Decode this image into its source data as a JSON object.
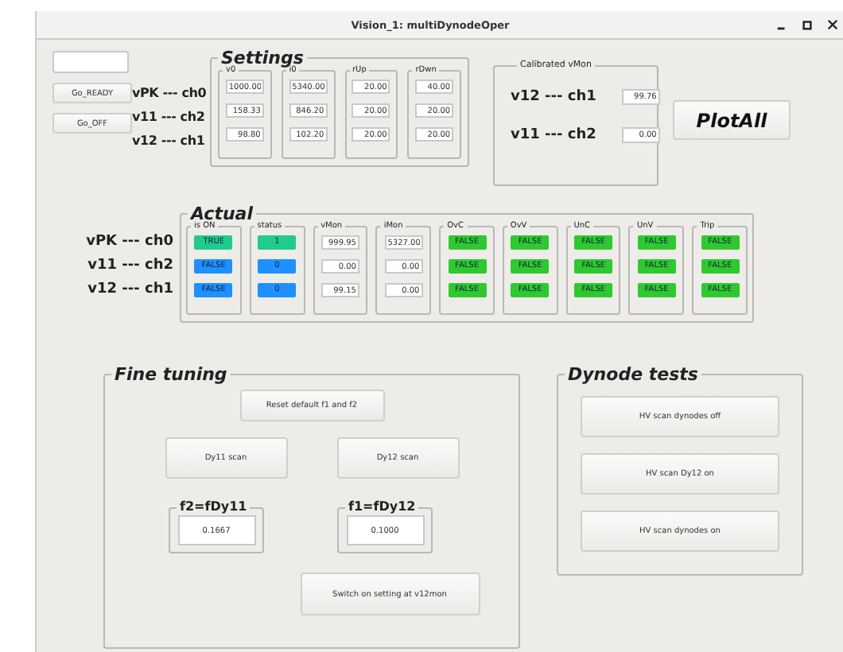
{
  "window": {
    "title": "Vision_1: multiDynodeOper"
  },
  "control_buttons": [
    "Go_READY",
    "Go_OFF"
  ],
  "channel_labels": [
    "vPK --- ch0",
    "v11 --- ch2",
    "v12 --- ch1"
  ],
  "settings": {
    "title": "Settings",
    "columns": [
      {
        "header": "v0",
        "values": [
          "1000.00",
          "158.33",
          "98.80"
        ]
      },
      {
        "header": "i0",
        "values": [
          "5340.00",
          "846.20",
          "102.20"
        ]
      },
      {
        "header": "rUp",
        "values": [
          "20.00",
          "20.00",
          "20.00"
        ]
      },
      {
        "header": "rDwn",
        "values": [
          "40.00",
          "20.00",
          "20.00"
        ]
      }
    ]
  },
  "calibrated_vmon": {
    "title": "Calibrated vMon",
    "rows": [
      {
        "label": "v12 --- ch1",
        "value": "99.76"
      },
      {
        "label": "v11 --- ch2",
        "value": "0.00"
      }
    ]
  },
  "plot_button": "PlotAll",
  "actual": {
    "title": "Actual",
    "row_labels": [
      "vPK --- ch0",
      "v11 --- ch2",
      "v12 --- ch1"
    ],
    "columns": [
      {
        "header": "is ON",
        "kind": "indicator",
        "cells": [
          {
            "text": "TRUE",
            "color": "#1fcc8c"
          },
          {
            "text": "FALSE",
            "color": "#1e90ff"
          },
          {
            "text": "FALSE",
            "color": "#1e90ff"
          }
        ]
      },
      {
        "header": "status",
        "kind": "indicator",
        "cells": [
          {
            "text": "1",
            "color": "#1fcc8c"
          },
          {
            "text": "0",
            "color": "#1e90ff"
          },
          {
            "text": "0",
            "color": "#1e90ff"
          }
        ]
      },
      {
        "header": "vMon",
        "kind": "field",
        "cells": [
          {
            "text": "999.95"
          },
          {
            "text": "0.00"
          },
          {
            "text": "99.15"
          }
        ]
      },
      {
        "header": "iMon",
        "kind": "field",
        "cells": [
          {
            "text": "5327.00"
          },
          {
            "text": "0.00"
          },
          {
            "text": "0.00"
          }
        ]
      },
      {
        "header": "OvC",
        "kind": "indicator",
        "cells": [
          {
            "text": "FALSE",
            "color": "#2ec92e"
          },
          {
            "text": "FALSE",
            "color": "#2ec92e"
          },
          {
            "text": "FALSE",
            "color": "#2ec92e"
          }
        ]
      },
      {
        "header": "OvV",
        "kind": "indicator",
        "cells": [
          {
            "text": "FALSE",
            "color": "#2ec92e"
          },
          {
            "text": "FALSE",
            "color": "#2ec92e"
          },
          {
            "text": "FALSE",
            "color": "#2ec92e"
          }
        ]
      },
      {
        "header": "UnC",
        "kind": "indicator",
        "cells": [
          {
            "text": "FALSE",
            "color": "#2ec92e"
          },
          {
            "text": "FALSE",
            "color": "#2ec92e"
          },
          {
            "text": "FALSE",
            "color": "#2ec92e"
          }
        ]
      },
      {
        "header": "UnV",
        "kind": "indicator",
        "cells": [
          {
            "text": "FALSE",
            "color": "#2ec92e"
          },
          {
            "text": "FALSE",
            "color": "#2ec92e"
          },
          {
            "text": "FALSE",
            "color": "#2ec92e"
          }
        ]
      },
      {
        "header": "Trip",
        "kind": "indicator",
        "cells": [
          {
            "text": "FALSE",
            "color": "#2ec92e"
          },
          {
            "text": "FALSE",
            "color": "#2ec92e"
          },
          {
            "text": "FALSE",
            "color": "#2ec92e"
          }
        ]
      }
    ]
  },
  "fine_tuning": {
    "title": "Fine tuning",
    "reset_button": "Reset default f1 and f2",
    "scan_buttons": [
      "Dy11 scan",
      "Dy12 scan"
    ],
    "factors": [
      {
        "title": "f2=fDy11",
        "value": "0.1667"
      },
      {
        "title": "f1=fDy12",
        "value": "0.1000"
      }
    ],
    "switch_button": "Switch on setting at v12mon"
  },
  "dynode_tests": {
    "title": "Dynode tests",
    "buttons": [
      "HV scan dynodes off",
      "HV scan Dy12 on",
      "HV scan dynodes on"
    ]
  }
}
